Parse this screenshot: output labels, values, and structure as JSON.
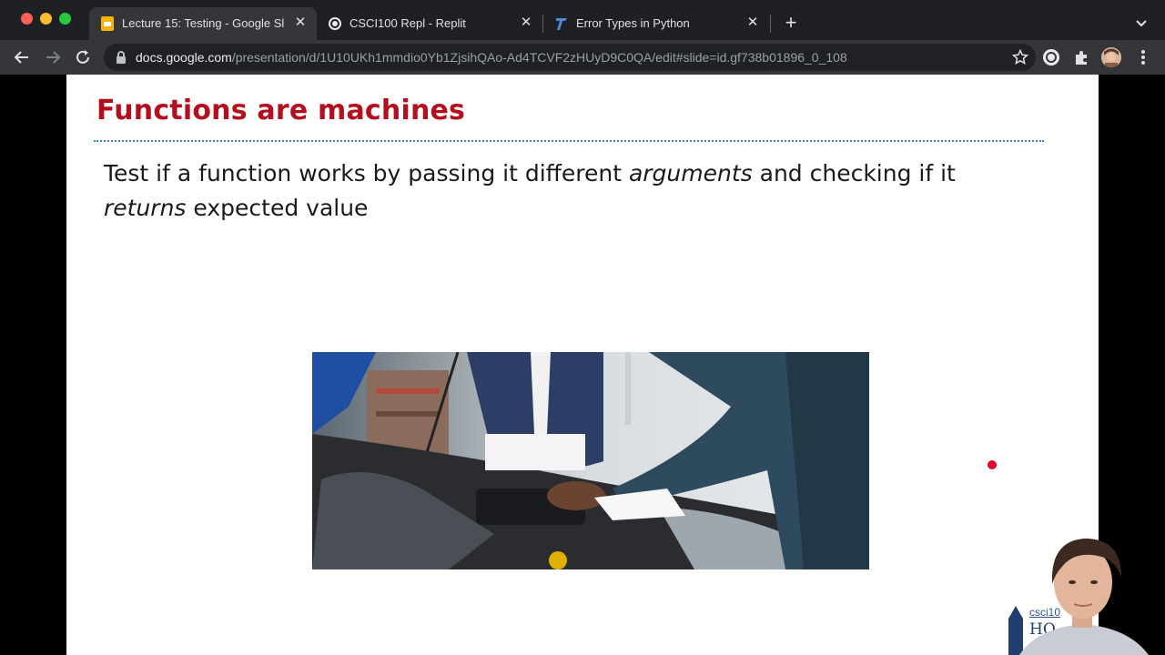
{
  "browser": {
    "tabs": [
      {
        "title": "Lecture 15: Testing - Google Sl",
        "active": true,
        "icon": "google-slides-icon"
      },
      {
        "title": "CSCI100 Repl - Replit",
        "active": false,
        "icon": "replit-icon"
      },
      {
        "title": "Error Types in Python",
        "active": false,
        "icon": "typora-icon"
      }
    ],
    "url_host": "docs.google.com",
    "url_path": "/presentation/d/1U10UKh1mmdio0Yb1ZjsihQAo-Ad4TCVF2zHUyD9C0QA/edit#slide=id.gf738b01896_0_108"
  },
  "slide": {
    "title": "Functions are machines",
    "body_part1": "Test if a function works by passing it different ",
    "body_em1": "arguments",
    "body_part2": " and checking if it ",
    "body_em2": "returns",
    "body_part3": " expected value",
    "logo_line1": "csci10",
    "logo_line2": "HO"
  },
  "colors": {
    "title": "#b30f1e",
    "divider": "#3b83c2",
    "laser": "#e8002d"
  }
}
